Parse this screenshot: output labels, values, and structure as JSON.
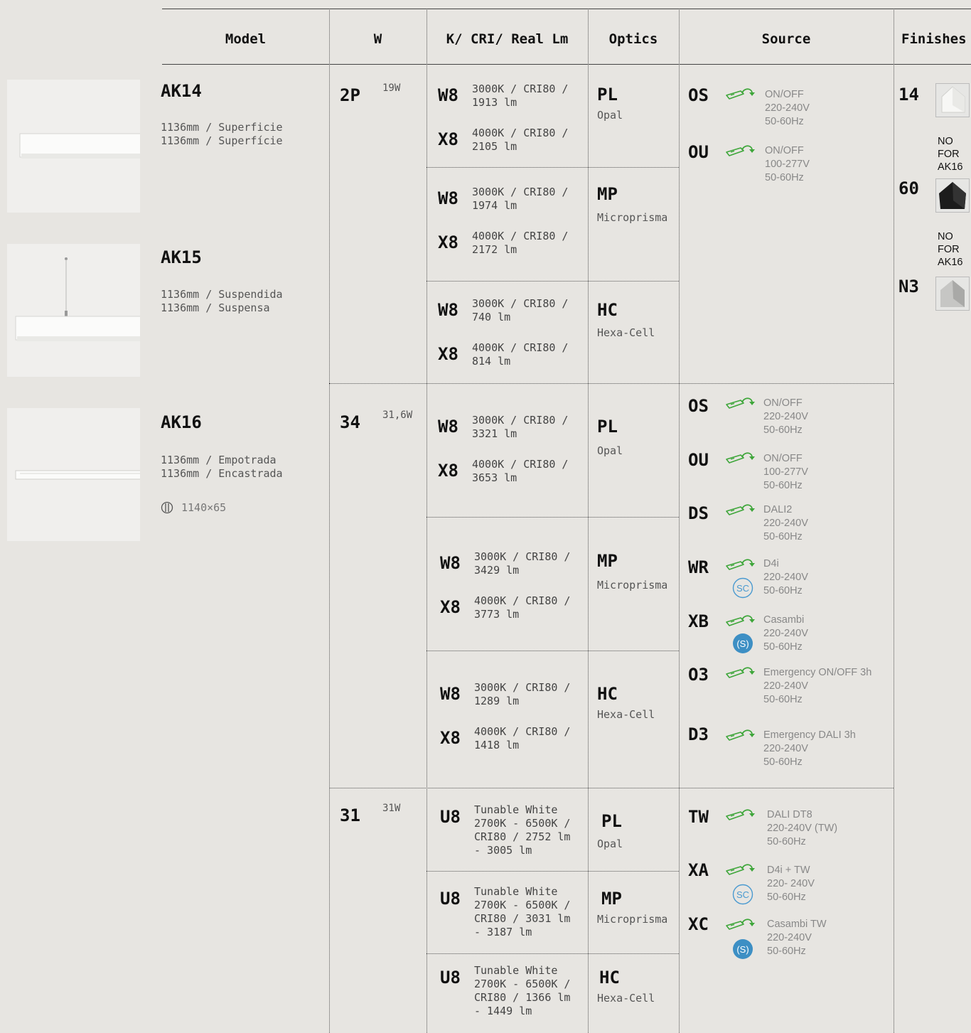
{
  "headers": {
    "model": "Model",
    "w": "W",
    "k": "K/ CRI/ Real Lm",
    "optics": "Optics",
    "source": "Source",
    "finishes": "Finishes"
  },
  "models": [
    {
      "code": "AK14",
      "desc": "1136mm / Superficie\n1136mm / Superfície"
    },
    {
      "code": "AK15",
      "desc": "1136mm / Suspendida\n1136mm / Suspensa"
    },
    {
      "code": "AK16",
      "desc": "1136mm / Empotrada\n1136mm / Encastrada",
      "cutout": "1140×65"
    }
  ],
  "watts": [
    {
      "code": "2P",
      "value": "19W"
    },
    {
      "code": "34",
      "value": "31,6W"
    },
    {
      "code": "31",
      "value": "31W"
    }
  ],
  "k": [
    {
      "code": "W8",
      "desc": "3000K / CRI80 /\n1913 lm"
    },
    {
      "code": "X8",
      "desc": "4000K / CRI80 /\n2105 lm"
    },
    {
      "code": "W8",
      "desc": "3000K / CRI80 /\n1974 lm"
    },
    {
      "code": "X8",
      "desc": "4000K / CRI80 /\n2172 lm"
    },
    {
      "code": "W8",
      "desc": "3000K / CRI80 /\n740 lm"
    },
    {
      "code": "X8",
      "desc": "4000K / CRI80 /\n814 lm"
    },
    {
      "code": "W8",
      "desc": "3000K / CRI80 /\n3321 lm"
    },
    {
      "code": "X8",
      "desc": "4000K / CRI80 /\n3653 lm"
    },
    {
      "code": "W8",
      "desc": "3000K / CRI80 /\n3429 lm"
    },
    {
      "code": "X8",
      "desc": "4000K / CRI80 /\n3773 lm"
    },
    {
      "code": "W8",
      "desc": "3000K / CRI80 /\n1289 lm"
    },
    {
      "code": "X8",
      "desc": "4000K / CRI80 /\n1418 lm"
    },
    {
      "code": "U8",
      "desc": "Tunable White\n2700K - 6500K /\nCRI80 / 2752 lm\n- 3005 lm"
    },
    {
      "code": "U8",
      "desc": "Tunable White\n2700K - 6500K /\nCRI80 / 3031 lm\n- 3187 lm"
    },
    {
      "code": "U8",
      "desc": "Tunable White\n2700K - 6500K /\nCRI80 / 1366 lm\n- 1449 lm"
    }
  ],
  "optics": [
    {
      "code": "PL",
      "name": "Opal"
    },
    {
      "code": "MP",
      "name": "Microprisma"
    },
    {
      "code": "HC",
      "name": "Hexa-Cell"
    },
    {
      "code": "PL",
      "name": "Opal"
    },
    {
      "code": "MP",
      "name": "Microprisma"
    },
    {
      "code": "HC",
      "name": "Hexa-Cell"
    },
    {
      "code": "PL",
      "name": "Opal"
    },
    {
      "code": "MP",
      "name": "Microprisma"
    },
    {
      "code": "HC",
      "name": "Hexa-Cell"
    }
  ],
  "sources": [
    {
      "code": "OS",
      "desc": "ON/OFF\n220-240V\n50-60Hz"
    },
    {
      "code": "OU",
      "desc": "ON/OFF\n100-277V\n50-60Hz"
    },
    {
      "code": "OS",
      "desc": "ON/OFF\n220-240V\n50-60Hz"
    },
    {
      "code": "OU",
      "desc": "ON/OFF\n100-277V\n50-60Hz"
    },
    {
      "code": "DS",
      "desc": "DALI2\n220-240V\n50-60Hz"
    },
    {
      "code": "WR",
      "desc": "D4i\n220-240V\n50-60Hz",
      "badge": "SC"
    },
    {
      "code": "XB",
      "desc": "Casambi\n220-240V\n50-60Hz",
      "badge": "(S)"
    },
    {
      "code": "O3",
      "desc": "Emergency ON/OFF 3h\n220-240V\n50-60Hz"
    },
    {
      "code": "D3",
      "desc": "Emergency DALI 3h\n220-240V\n50-60Hz"
    },
    {
      "code": "TW",
      "desc": "DALI DT8\n220-240V (TW)\n50-60Hz"
    },
    {
      "code": "XA",
      "desc": "D4i + TW\n220- 240V\n50-60Hz",
      "badge": "SC"
    },
    {
      "code": "XC",
      "desc": "Casambi TW\n220-240V\n50-60Hz",
      "badge": "(S)"
    }
  ],
  "finishes": [
    {
      "code": "14",
      "note": "NO\nFOR\nAK16",
      "swatch": "#f4f4f2"
    },
    {
      "code": "60",
      "note": "NO\nFOR\nAK16",
      "swatch": "#1e1e1e"
    },
    {
      "code": "N3",
      "swatch": "#b8b8b6"
    }
  ],
  "colors": {
    "driver_icon": "#3ea63a",
    "badge_outline": "#4a9ad0",
    "badge_fill": "#3d8fc4"
  }
}
